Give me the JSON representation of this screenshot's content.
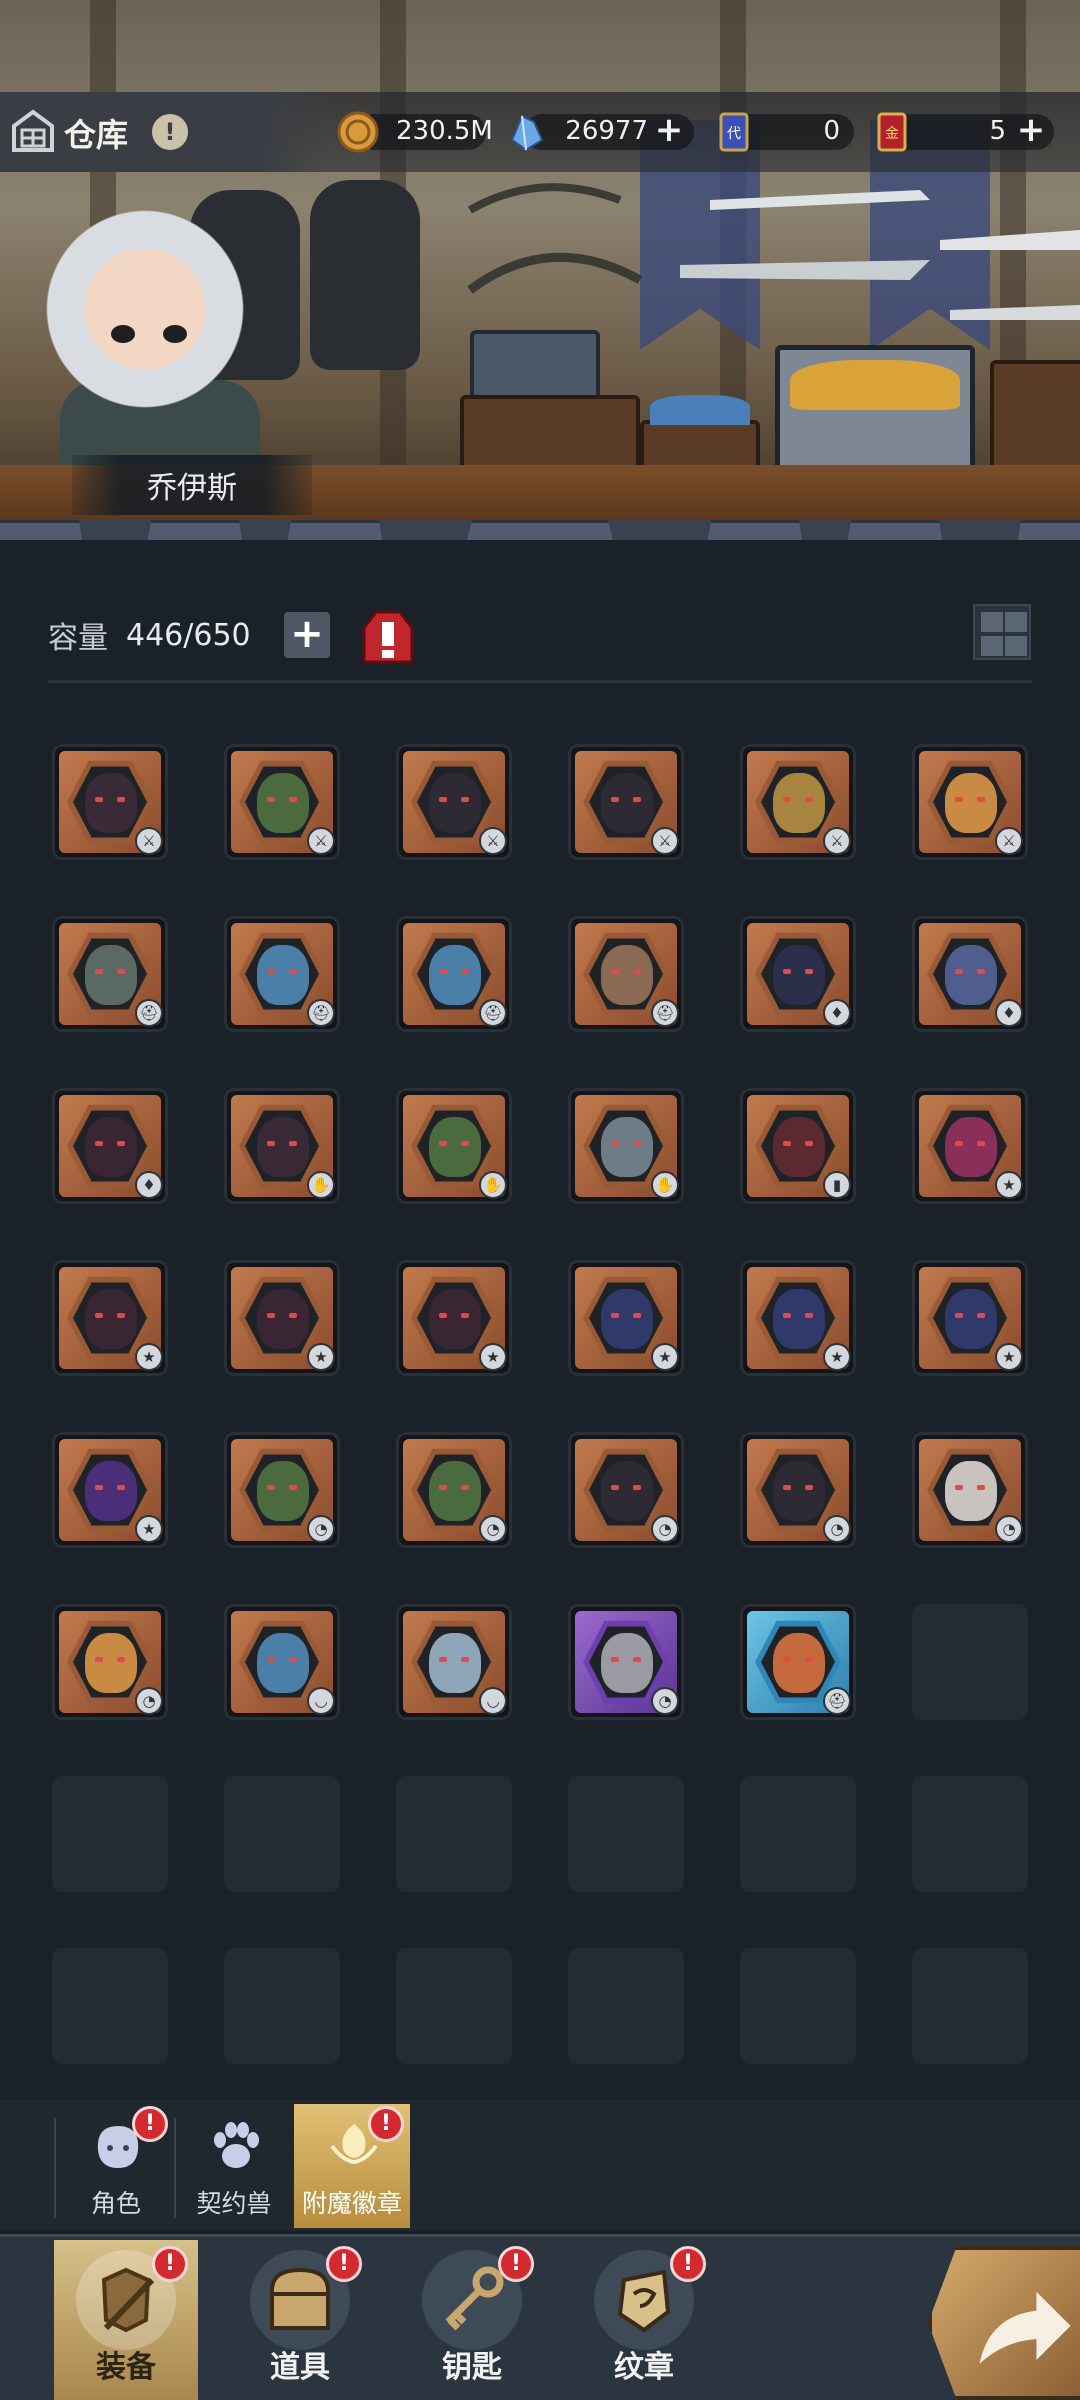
{
  "header": {
    "title": "仓库",
    "alert_glyph": "!",
    "character_name": "乔伊斯"
  },
  "resources": [
    {
      "icon": "gold-coin-icon",
      "value": "230.5M",
      "has_plus": false
    },
    {
      "icon": "blue-crystal-icon",
      "value": "26977",
      "has_plus": true
    },
    {
      "icon": "blue-ticket-icon",
      "value": "0",
      "has_plus": false
    },
    {
      "icon": "red-gold-ticket-icon",
      "value": "5",
      "has_plus": true
    }
  ],
  "capacity": {
    "label": "容量",
    "value": "446/650",
    "plus": "+"
  },
  "items": [
    {
      "rarity": "bronze",
      "monster_color": "#3a2a36",
      "slot_icon": "weapon"
    },
    {
      "rarity": "bronze",
      "monster_color": "#4b6b3e",
      "slot_icon": "weapon"
    },
    {
      "rarity": "bronze",
      "monster_color": "#2d2a33",
      "slot_icon": "weapon"
    },
    {
      "rarity": "bronze",
      "monster_color": "#2d2a33",
      "slot_icon": "weapon"
    },
    {
      "rarity": "bronze",
      "monster_color": "#a8843e",
      "slot_icon": "weapon"
    },
    {
      "rarity": "bronze",
      "monster_color": "#c98b43",
      "slot_icon": "weapon"
    },
    {
      "rarity": "bronze",
      "monster_color": "#5a6a62",
      "slot_icon": "helmet"
    },
    {
      "rarity": "bronze",
      "monster_color": "#4a7fa8",
      "slot_icon": "helmet"
    },
    {
      "rarity": "bronze",
      "monster_color": "#4a7fa8",
      "slot_icon": "helmet"
    },
    {
      "rarity": "bronze",
      "monster_color": "#8a6a52",
      "slot_icon": "helmet"
    },
    {
      "rarity": "bronze",
      "monster_color": "#2b2f4a",
      "slot_icon": "armor"
    },
    {
      "rarity": "bronze",
      "monster_color": "#4f5d8f",
      "slot_icon": "armor"
    },
    {
      "rarity": "bronze",
      "monster_color": "#3a2533",
      "slot_icon": "armor"
    },
    {
      "rarity": "bronze",
      "monster_color": "#3a2a36",
      "slot_icon": "glove"
    },
    {
      "rarity": "bronze",
      "monster_color": "#4b6b3e",
      "slot_icon": "glove"
    },
    {
      "rarity": "bronze",
      "monster_color": "#6e7c86",
      "slot_icon": "glove"
    },
    {
      "rarity": "bronze",
      "monster_color": "#5a2a30",
      "slot_icon": "boots"
    },
    {
      "rarity": "bronze",
      "monster_color": "#8a2e5a",
      "slot_icon": "ring"
    },
    {
      "rarity": "bronze",
      "monster_color": "#3a2533",
      "slot_icon": "ring"
    },
    {
      "rarity": "bronze",
      "monster_color": "#3a2533",
      "slot_icon": "ring"
    },
    {
      "rarity": "bronze",
      "monster_color": "#3a2533",
      "slot_icon": "ring"
    },
    {
      "rarity": "bronze",
      "monster_color": "#2f3a6a",
      "slot_icon": "ring"
    },
    {
      "rarity": "bronze",
      "monster_color": "#2f3a6a",
      "slot_icon": "ring"
    },
    {
      "rarity": "bronze",
      "monster_color": "#2f3a6a",
      "slot_icon": "ring"
    },
    {
      "rarity": "bronze",
      "monster_color": "#4a2e7a",
      "slot_icon": "ring"
    },
    {
      "rarity": "bronze",
      "monster_color": "#4b6b3e",
      "slot_icon": "necklace"
    },
    {
      "rarity": "bronze",
      "monster_color": "#4b6b3e",
      "slot_icon": "necklace"
    },
    {
      "rarity": "bronze",
      "monster_color": "#2d2a33",
      "slot_icon": "necklace"
    },
    {
      "rarity": "bronze",
      "monster_color": "#2d2a33",
      "slot_icon": "necklace"
    },
    {
      "rarity": "bronze",
      "monster_color": "#c9c3bf",
      "slot_icon": "necklace"
    },
    {
      "rarity": "bronze",
      "monster_color": "#c98b43",
      "slot_icon": "necklace"
    },
    {
      "rarity": "bronze",
      "monster_color": "#4a7fa8",
      "slot_icon": "earring"
    },
    {
      "rarity": "bronze",
      "monster_color": "#8fa6b8",
      "slot_icon": "earring"
    },
    {
      "rarity": "purple",
      "monster_color": "#9a9aa2",
      "slot_icon": "necklace"
    },
    {
      "rarity": "blue",
      "monster_color": "#c46a3c",
      "slot_icon": "helmet"
    }
  ],
  "empty_slots": 13,
  "sub_tabs": [
    {
      "label": "角色",
      "icon": "character-icon",
      "active": false,
      "alert": true
    },
    {
      "label": "契约兽",
      "icon": "paw-icon",
      "active": false,
      "alert": false
    },
    {
      "label": "附魔徽章",
      "icon": "enchant-emblem-icon",
      "active": true,
      "alert": true
    }
  ],
  "nav_tabs": [
    {
      "label": "装备",
      "icon": "equipment-icon",
      "active": true,
      "alert": true
    },
    {
      "label": "道具",
      "icon": "chest-icon",
      "active": false,
      "alert": true
    },
    {
      "label": "钥匙",
      "icon": "key-icon",
      "active": false,
      "alert": true
    },
    {
      "label": "纹章",
      "icon": "crest-icon",
      "active": false,
      "alert": true
    }
  ],
  "go_button": {
    "icon": "forward-arrow-icon"
  }
}
